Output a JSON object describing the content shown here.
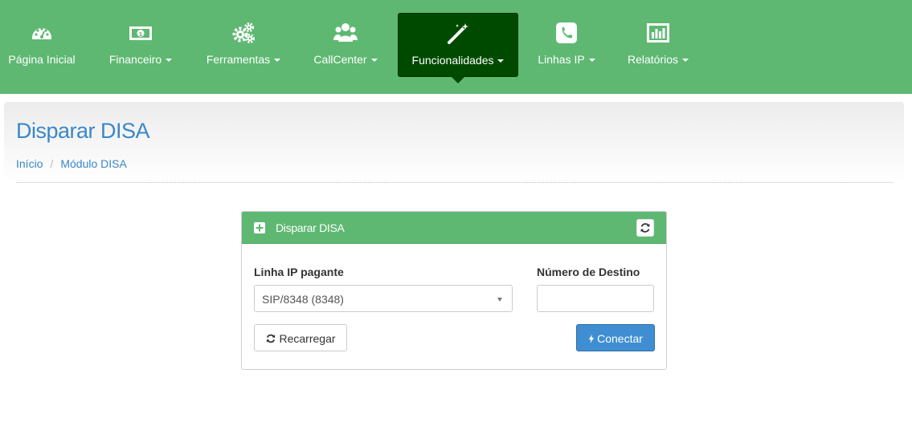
{
  "nav": {
    "items": [
      {
        "label": "Página Inicial",
        "icon": "dashboard-icon",
        "dropdown": false
      },
      {
        "label": "Financeiro",
        "icon": "money-icon",
        "dropdown": true
      },
      {
        "label": "Ferramentas",
        "icon": "gears-icon",
        "dropdown": true
      },
      {
        "label": "CallCenter",
        "icon": "users-icon",
        "dropdown": true
      },
      {
        "label": "Funcionalidades",
        "icon": "magic-wand-icon",
        "dropdown": true,
        "active": true
      },
      {
        "label": "Linhas IP",
        "icon": "phone-icon",
        "dropdown": true
      },
      {
        "label": "Relatórios",
        "icon": "bar-chart-icon",
        "dropdown": true
      }
    ]
  },
  "page": {
    "title": "Disparar DISA",
    "breadcrumb": [
      "Início",
      "Módulo DISA"
    ]
  },
  "panel": {
    "title": "Disparar DISA",
    "linha_label": "Linha IP pagante",
    "linha_value": "SIP/8348 (8348)",
    "destino_label": "Número de Destino",
    "destino_value": "",
    "reload_label": "Recarregar",
    "connect_label": "Conectar"
  },
  "colors": {
    "nav_bg": "#5eb872",
    "nav_active": "#004a00",
    "link": "#3a87c9",
    "primary_button": "#3f8ed2"
  }
}
